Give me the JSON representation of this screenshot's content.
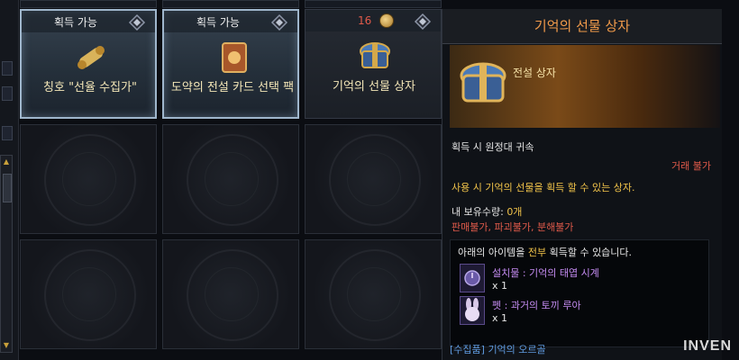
{
  "slots": [
    {
      "tag": "획득 가능",
      "count": "",
      "name": "칭호 \"선율 수집가\"",
      "selected": true
    },
    {
      "tag": "획득 가능",
      "count": "",
      "name": "도약의 전설 카드 선택 팩",
      "selected": true
    },
    {
      "tag": "",
      "count": "16",
      "name": "기억의 선물 상자",
      "selected": false
    }
  ],
  "panel": {
    "title": "기억의 선물 상자",
    "grade": "전설 상자",
    "bind": "획득 시 원정대 귀속",
    "trade": "거래 불가",
    "desc": "사용 시 기억의 선물을 획득 할 수 있는 상자.",
    "own_label": "내 보유수량: ",
    "own_value": "0개",
    "flags": "판매불가, 파괴불가, 분해불가",
    "box": {
      "title_pre": "아래의 아이템을 ",
      "title_hl": "전부",
      "title_post": " 획득할 수 있습니다.",
      "rewards": [
        {
          "name": "설치물 : 기억의 태엽 시계",
          "qty": "x 1"
        },
        {
          "name": "펫 : 과거의 토끼 루아",
          "qty": "x 1"
        }
      ]
    },
    "collect": "[수집품] 기억의 오르골"
  },
  "watermark": "INVEN",
  "colors": {
    "title": "#f09a4a",
    "gold": "#f2c44a",
    "red": "#e05a4a",
    "purple": "#c58cf2",
    "blue": "#5f9be0"
  }
}
